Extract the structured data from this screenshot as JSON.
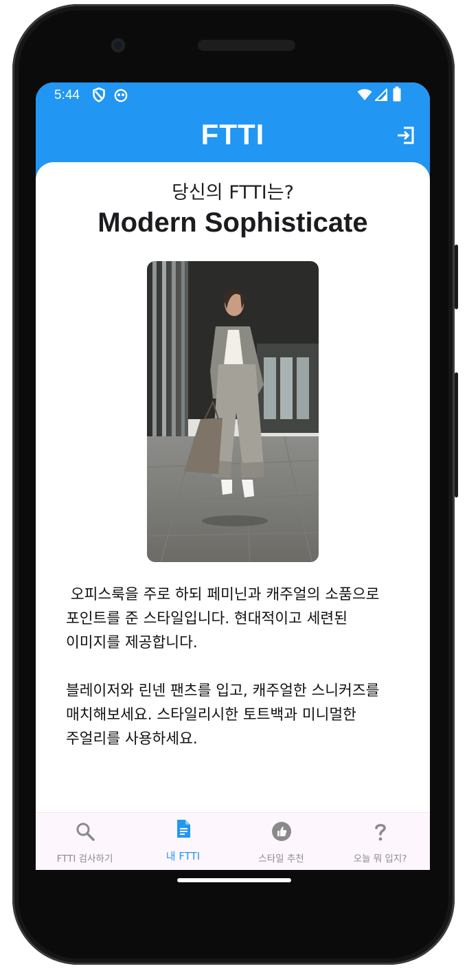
{
  "status_bar": {
    "time": "5:44"
  },
  "app_bar": {
    "title": "FTTI"
  },
  "result": {
    "question": "당신의 FTTI는?",
    "type_name": "Modern Sophisticate",
    "paragraph_1": " 오피스룩을 주로 하되 페미닌과 캐주얼의 소품으로 포인트를 준 스타일입니다. 현대적이고 세련된 이미지를 제공합니다.",
    "paragraph_2": "블레이저와 린넨 팬츠를 입고, 캐주얼한 스니커즈를 매치해보세요. 스타일리시한 토트백과 미니멀한 주얼리를 사용하세요."
  },
  "bottom_nav": {
    "items": [
      {
        "label": "FTTI 검사하기",
        "icon": "search-icon"
      },
      {
        "label": "내 FTTI",
        "icon": "document-icon"
      },
      {
        "label": "스타일 추천",
        "icon": "thumbs-up-icon"
      },
      {
        "label": "오늘 뭐 입지?",
        "icon": "question-icon"
      }
    ],
    "active_index": 1
  },
  "colors": {
    "primary": "#2196f3",
    "nav_background": "#fdf7fd",
    "inactive_label": "#8a8a8a"
  }
}
